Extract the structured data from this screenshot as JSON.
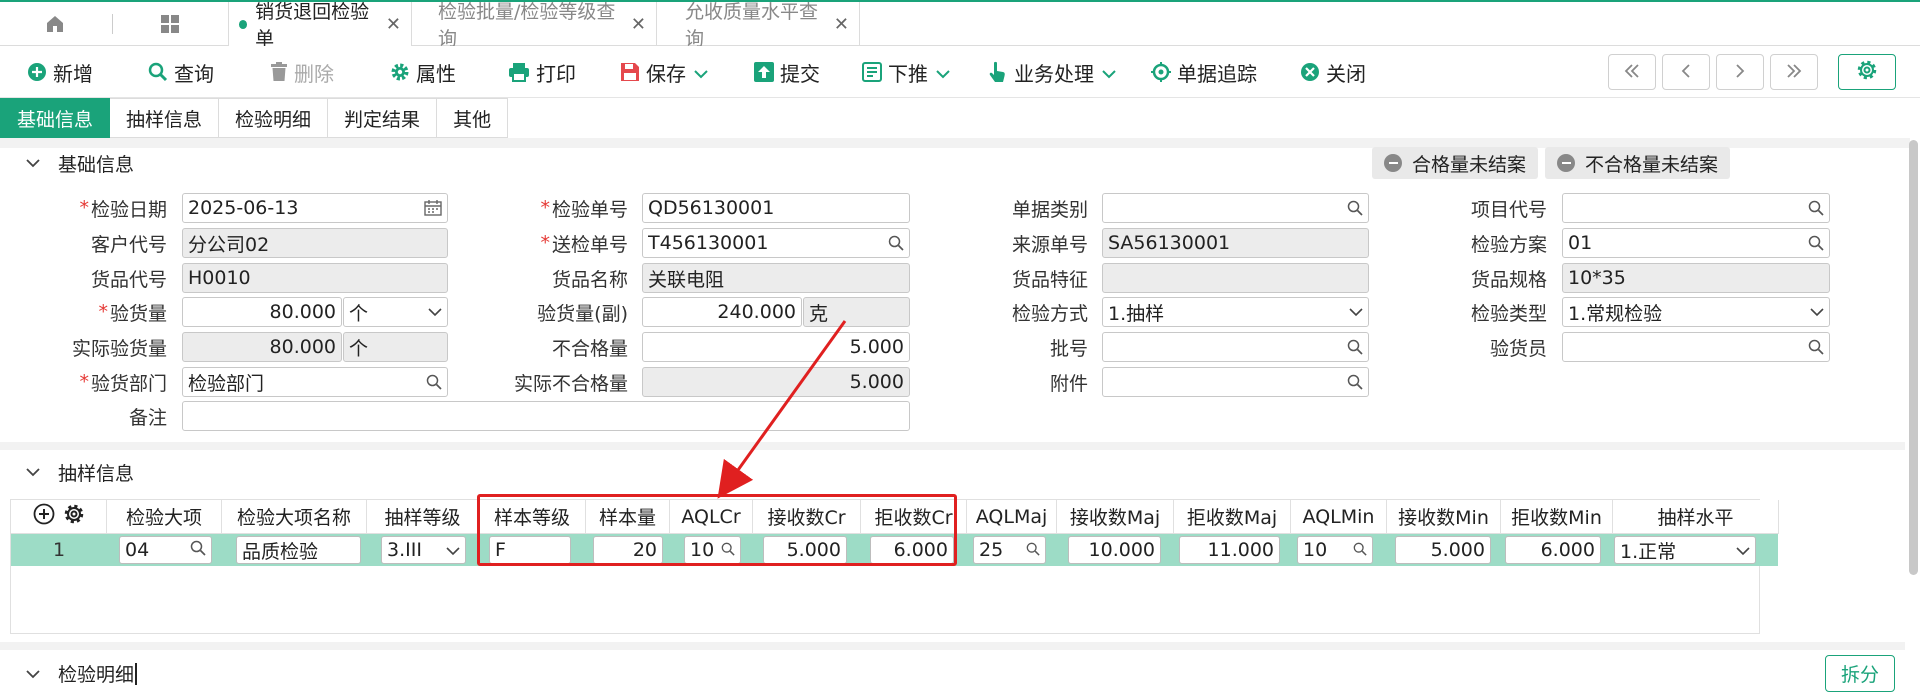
{
  "tabs": {
    "items": [
      {
        "label": "销货退回检验单",
        "active": true
      },
      {
        "label": "检验批量/检验等级查询",
        "active": false
      },
      {
        "label": "允收质量水平查询",
        "active": false
      }
    ]
  },
  "toolbar": {
    "new": "新增",
    "query": "查询",
    "delete": "删除",
    "properties": "属性",
    "print": "打印",
    "save": "保存",
    "submit": "提交",
    "push_down": "下推",
    "business": "业务处理",
    "trace": "单据追踪",
    "close": "关闭"
  },
  "section_tabs": [
    "基础信息",
    "抽样信息",
    "检验明细",
    "判定结果",
    "其他"
  ],
  "basic": {
    "title": "基础信息",
    "badge_pass": "合格量未结案",
    "badge_fail": "不合格量未结案",
    "labels": {
      "inspect_date": "检验日期",
      "customer_code": "客户代号",
      "item_code": "货品代号",
      "inspect_qty": "验货量",
      "actual_inspect_qty": "实际验货量",
      "inspect_dept": "验货部门",
      "remark": "备注",
      "inspect_no": "检验单号",
      "submit_no": "送检单号",
      "item_name": "货品名称",
      "inspect_qty_sub": "验货量(副)",
      "unqualified_qty": "不合格量",
      "actual_unqualified_qty": "实际不合格量",
      "doc_type": "单据类别",
      "source_no": "来源单号",
      "item_feature": "货品特征",
      "inspect_method": "检验方式",
      "batch_no": "批号",
      "attachment": "附件",
      "project_code": "项目代号",
      "inspect_plan": "检验方案",
      "item_spec": "货品规格",
      "inspect_type": "检验类型",
      "inspector": "验货员"
    },
    "values": {
      "inspect_date": "2025-06-13",
      "customer_code": "分公司02",
      "item_code": "H0010",
      "inspect_qty": "80.000",
      "inspect_qty_unit": "个",
      "actual_inspect_qty": "80.000",
      "actual_inspect_unit": "个",
      "inspect_dept": "检验部门",
      "remark": "",
      "inspect_no": "QD56130001",
      "submit_no": "T456130001",
      "item_name": "关联电阻",
      "inspect_qty_sub": "240.000",
      "inspect_qty_sub_unit": "克",
      "unqualified_qty": "5.000",
      "actual_unqualified_qty": "5.000",
      "doc_type": "",
      "source_no": "SA56130001",
      "item_feature": "",
      "inspect_method": "1.抽样",
      "batch_no": "",
      "attachment": "",
      "project_code": "",
      "inspect_plan": "01",
      "item_spec": "10*35",
      "inspect_type": "1.常规检验",
      "inspector": ""
    }
  },
  "sampling": {
    "title": "抽样信息",
    "columns": [
      "检验大项",
      "检验大项名称",
      "抽样等级",
      "样本等级",
      "样本量",
      "AQLCr",
      "接收数Cr",
      "拒收数Cr",
      "AQLMaj",
      "接收数Maj",
      "拒收数Maj",
      "AQLMin",
      "接收数Min",
      "拒收数Min",
      "抽样水平"
    ],
    "row": {
      "index": "1",
      "major_item": "04",
      "major_item_name": "品质检验",
      "sampling_grade": "3.III",
      "sample_grade": "F",
      "sample_size": "20",
      "aql_cr": "10",
      "accept_cr": "5.000",
      "reject_cr": "6.000",
      "aql_maj": "25",
      "accept_maj": "10.000",
      "reject_maj": "11.000",
      "aql_min": "10",
      "accept_min": "5.000",
      "reject_min": "6.000",
      "sampling_level": "1.正常"
    }
  },
  "detail": {
    "title": "检验明细",
    "split": "拆分"
  },
  "colors": {
    "accent": "#1aa37a",
    "row_highlight": "#9ddcc6",
    "annotation": "#e02020"
  }
}
